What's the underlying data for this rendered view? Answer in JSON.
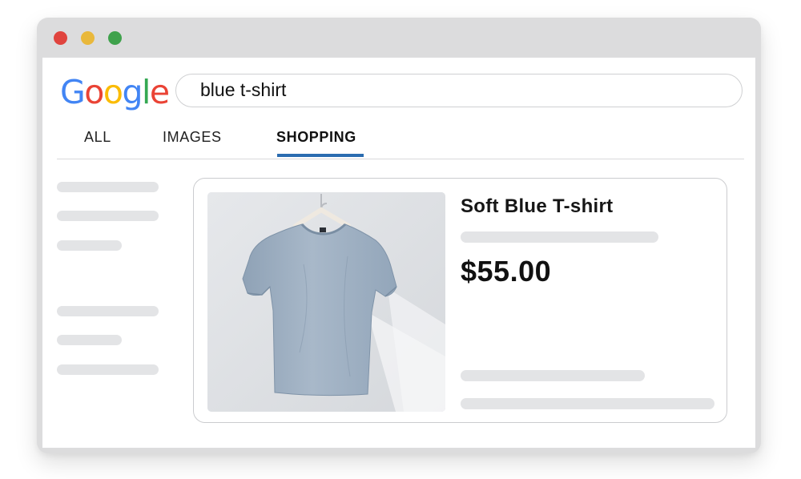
{
  "window": {
    "controls": [
      "close",
      "minimize",
      "maximize"
    ]
  },
  "search": {
    "logo_text": "Google",
    "query": "blue t-shirt"
  },
  "tabs": [
    {
      "label": "ALL",
      "active": false
    },
    {
      "label": "IMAGES",
      "active": false
    },
    {
      "label": "SHOPPING",
      "active": true
    }
  ],
  "product": {
    "title": "Soft Blue T-shirt",
    "price": "$55.00",
    "image": "blue t-shirt on hanger"
  },
  "colors": {
    "accent": "#2b6cb0",
    "google_blue": "#4285f4",
    "google_red": "#ea4335",
    "google_yellow": "#fbbc05",
    "google_green": "#34a853",
    "placeholder_gray": "#e3e4e6"
  }
}
